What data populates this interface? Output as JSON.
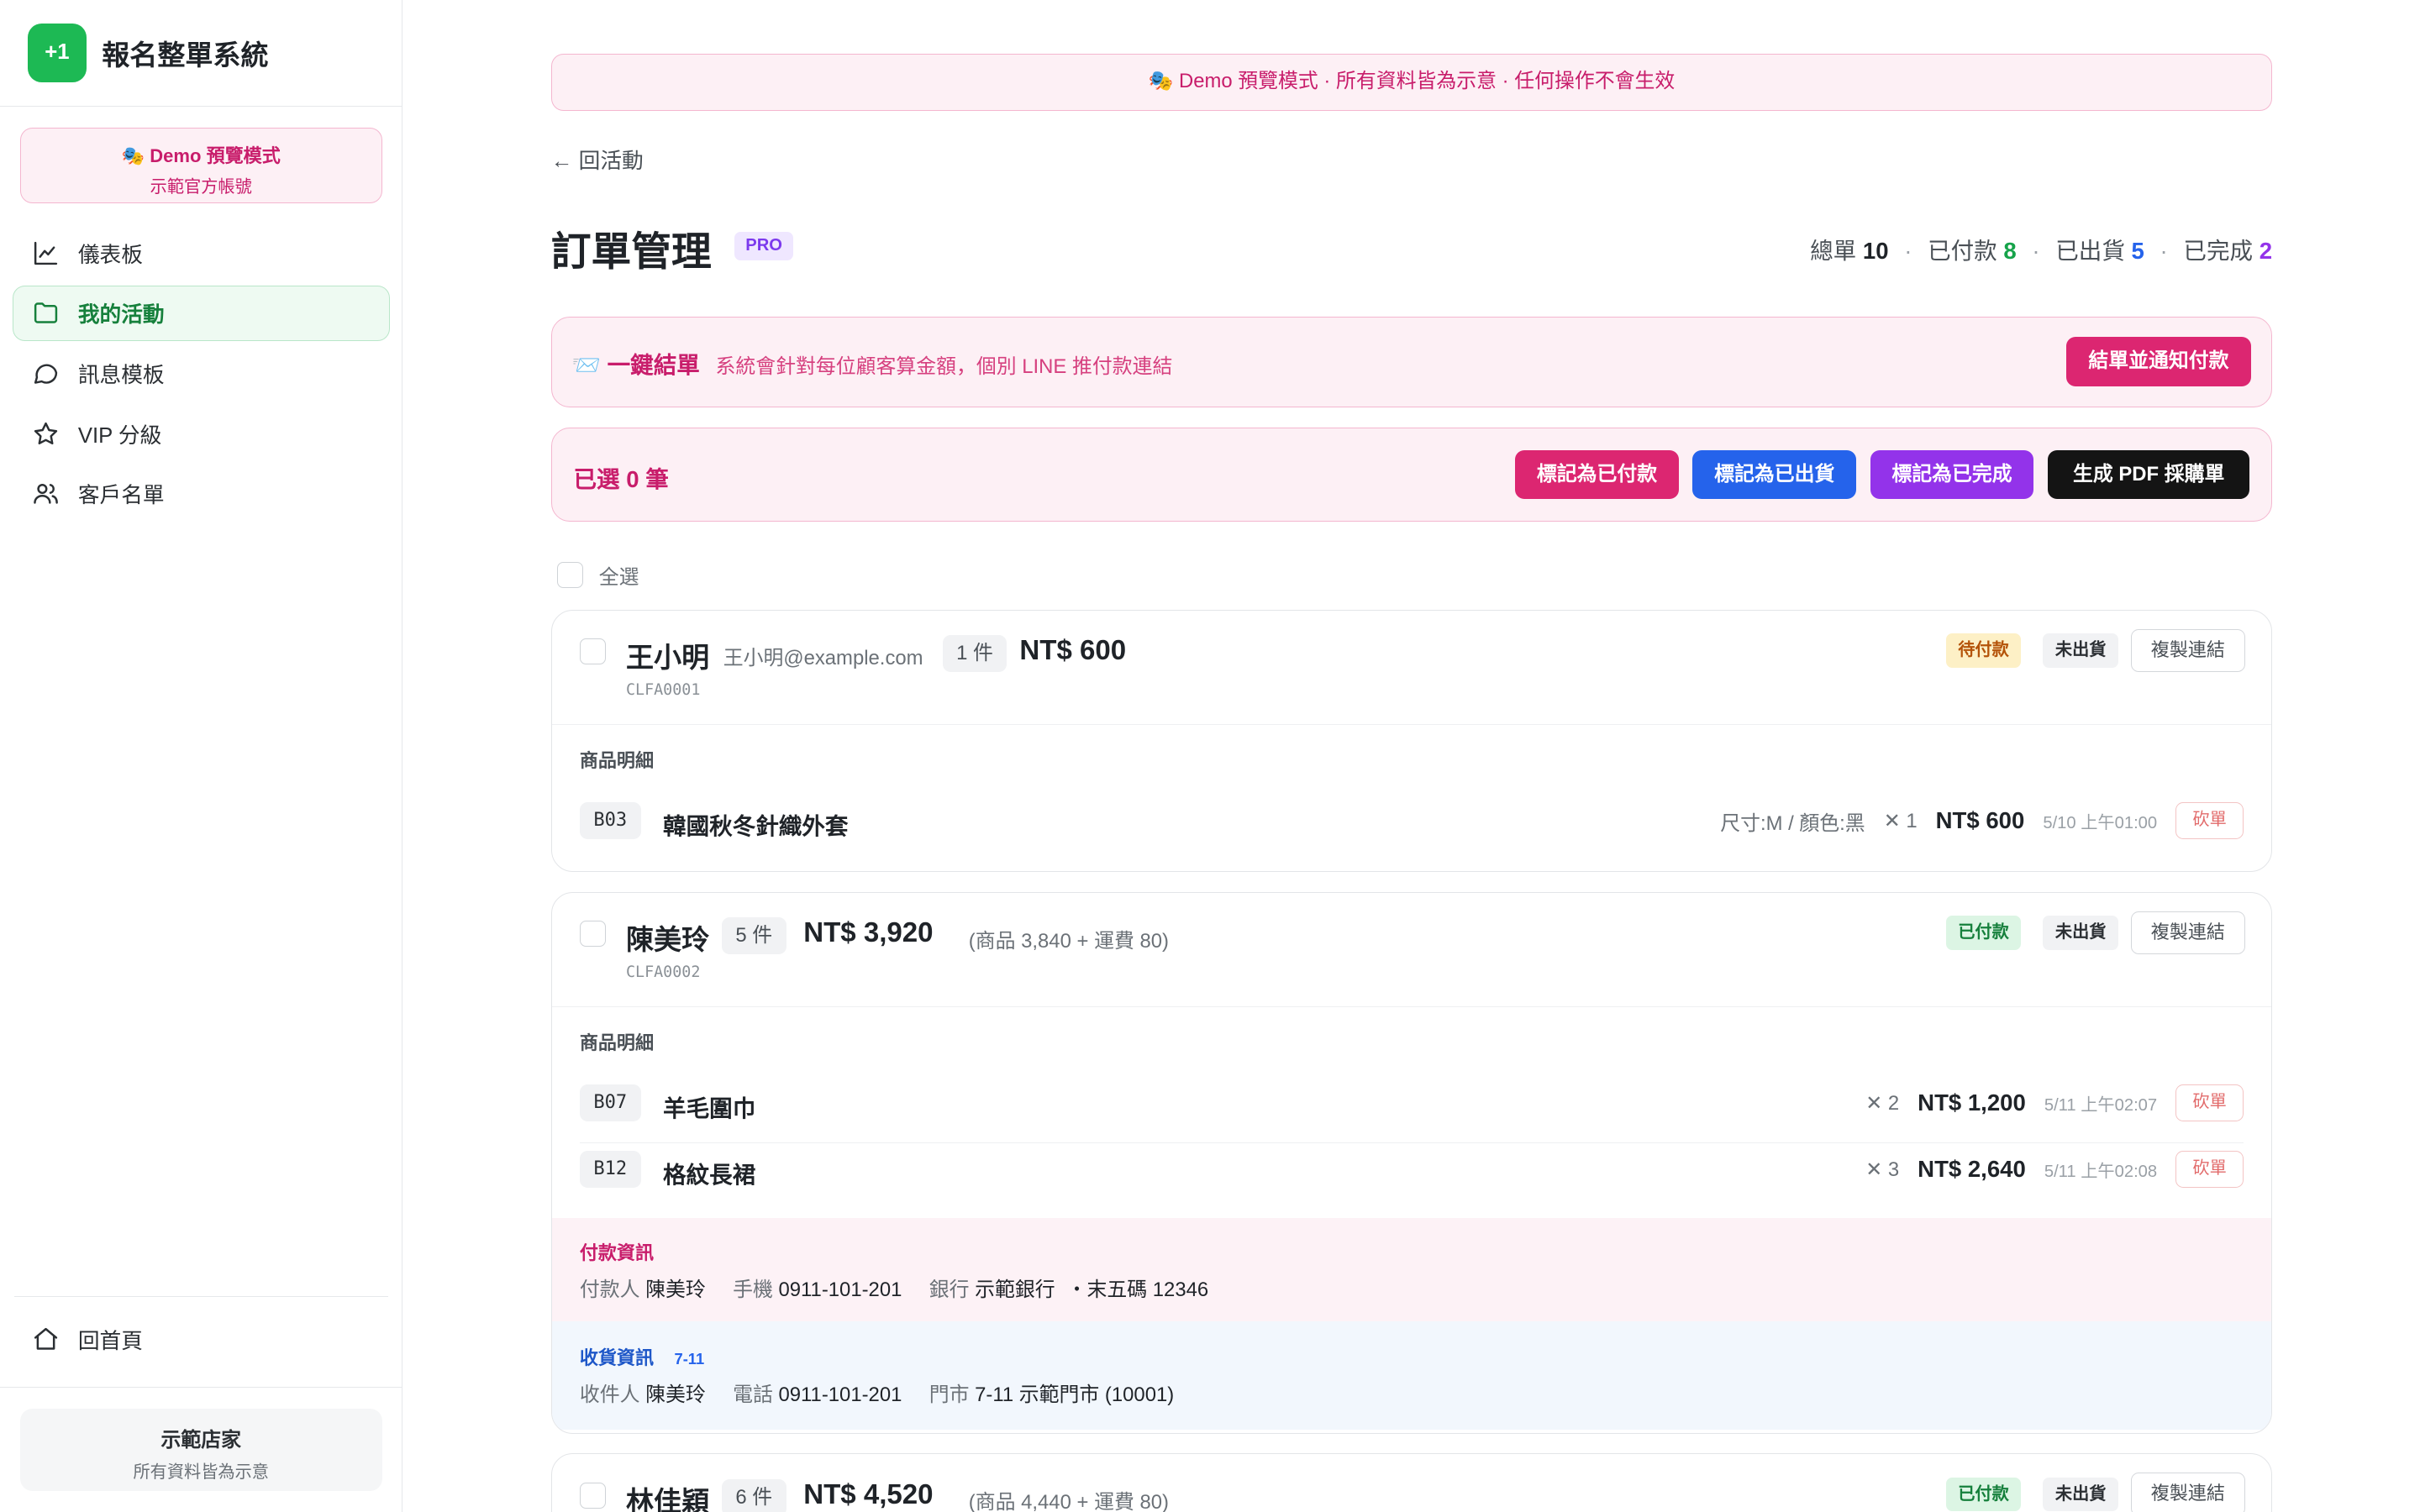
{
  "brand": {
    "logo": "+1",
    "name": "報名整單系統"
  },
  "demo_card": {
    "title": "🎭 Demo 預覽模式",
    "subtitle": "示範官方帳號"
  },
  "nav": [
    {
      "label": "儀表板",
      "icon": "chart-line-icon"
    },
    {
      "label": "我的活動",
      "icon": "folder-icon",
      "active": true
    },
    {
      "label": "訊息模板",
      "icon": "chat-bubble-icon"
    },
    {
      "label": "VIP 分級",
      "icon": "star-icon"
    },
    {
      "label": "客戶名單",
      "icon": "users-icon"
    }
  ],
  "home_link": "回首頁",
  "store": {
    "name": "示範店家",
    "note": "所有資料皆為示意"
  },
  "banner": "🎭 Demo 預覽模式 · 所有資料皆為示意 · 任何操作不會生效",
  "back_link": "← 回活動",
  "page_title": "訂單管理",
  "pro_badge": "PRO",
  "stats": {
    "total_label": "總單",
    "total": "10",
    "paid_label": "已付款",
    "paid": "8",
    "shipped_label": "已出貨",
    "shipped": "5",
    "done_label": "已完成",
    "done": "2",
    "sep": "·"
  },
  "one_click": {
    "title": "📨 一鍵結單",
    "desc": "系統會針對每位顧客算金額，個別 LINE 推付款連結",
    "button": "結單並通知付款"
  },
  "selection": {
    "label": "已選 0 筆",
    "btn_paid": "標記為已付款",
    "btn_shipped": "標記為已出貨",
    "btn_done": "標記為已完成",
    "btn_pdf": "生成 PDF 採購單"
  },
  "select_all": "全選",
  "items_header": "商品明細",
  "cut_label": "砍單",
  "copy_label": "複製連結",
  "orders": [
    {
      "name": "王小明",
      "email": "王小明@example.com",
      "qty": "1 件",
      "total": "NT$ 600",
      "code": "CLFA0001",
      "pay_status": "待付款",
      "ship_status": "未出貨",
      "items": [
        {
          "sku": "B03",
          "name": "韓國秋冬針織外套",
          "variant": "尺寸:M / 顏色:黑",
          "qty": "✕ 1",
          "price": "NT$ 600",
          "time": "5/10 上午01:00"
        }
      ]
    },
    {
      "name": "陳美玲",
      "qty": "5 件",
      "total": "NT$ 3,920",
      "breakdown": "(商品 3,840 + 運費 80)",
      "code": "CLFA0002",
      "pay_status": "已付款",
      "ship_status": "未出貨",
      "items": [
        {
          "sku": "B07",
          "name": "羊毛圍巾",
          "qty": "✕ 2",
          "price": "NT$ 1,200",
          "time": "5/11 上午02:07"
        },
        {
          "sku": "B12",
          "name": "格紋長裙",
          "qty": "✕ 3",
          "price": "NT$ 2,640",
          "time": "5/11 上午02:08"
        }
      ],
      "payment": {
        "title": "付款資訊",
        "payer_label": "付款人",
        "payer": "陳美玲",
        "phone_label": "手機",
        "phone": "0911-101-201",
        "bank_label": "銀行",
        "bank": "示範銀行",
        "last5_label": "・末五碼",
        "last5": "12346"
      },
      "shipping": {
        "title": "收貨資訊",
        "store_type": "7-11",
        "receiver_label": "收件人",
        "receiver": "陳美玲",
        "phone_label": "電話",
        "phone": "0911-101-201",
        "store_label": "門市",
        "store": "7-11 示範門市 (10001)"
      }
    },
    {
      "name": "林佳穎",
      "qty": "6 件",
      "total": "NT$ 4,520",
      "breakdown": "(商品 4,440 + 運費 80)",
      "pay_status": "已付款",
      "ship_status": "未出貨"
    }
  ],
  "colors": {
    "accent_green": "#1db954",
    "pink": "#dc2671",
    "blue": "#2563eb",
    "purple": "#9333ea"
  }
}
